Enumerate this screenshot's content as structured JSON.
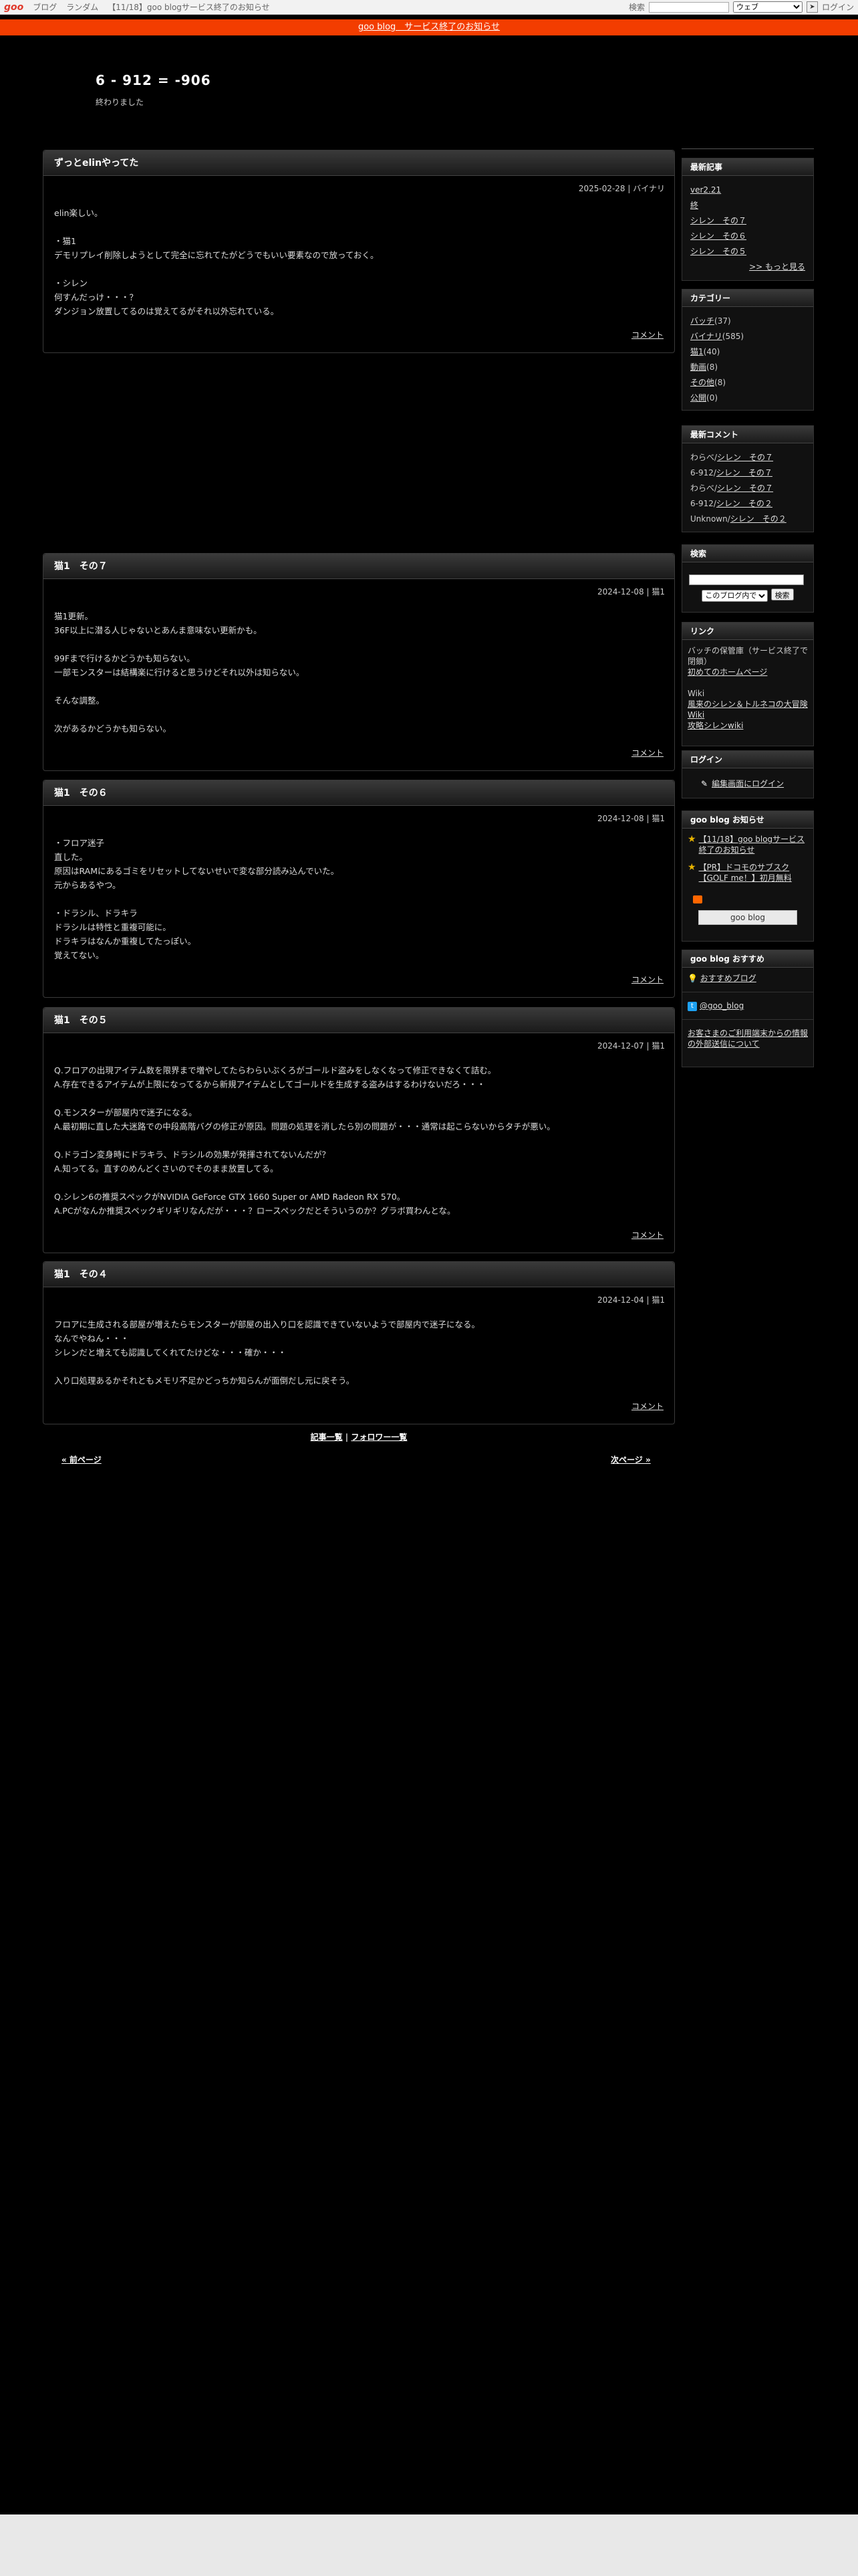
{
  "topbar": {
    "logo": "goo",
    "links": [
      "ブログ",
      "ランダム",
      "【11/18】goo blogサービス終了のお知らせ"
    ],
    "search_label": "検索",
    "search_select": "ウェブ",
    "login": "ログイン"
  },
  "notice": "goo blog　サービス終了のお知らせ",
  "blog": {
    "title": "6 - 912 = -906",
    "description": "終わりました"
  },
  "entries": [
    {
      "title": "ずっとelinやってた",
      "meta": "2025-02-28 | バイナリ",
      "body": "elin楽しい。\n\n・猫1\nデモリプレイ削除しようとして完全に忘れてたがどうでもいい要素なので放っておく。\n\n・シレン\n何すんだっけ・・・？\nダンジョン放置してるのは覚えてるがそれ以外忘れている。",
      "footer": "コメント"
    },
    {
      "title": "猫1　その７",
      "meta": "2024-12-08 | 猫1",
      "body": "猫1更新。\n36F以上に潜る人じゃないとあんま意味ない更新かも。\n\n99Fまで行けるかどうかも知らない。\n一部モンスターは結構楽に行けると思うけどそれ以外は知らない。\n\nそんな調整。\n\n次があるかどうかも知らない。",
      "footer": "コメント"
    },
    {
      "title": "猫1　その６",
      "meta": "2024-12-08 | 猫1",
      "body": "・フロア迷子\n直した。\n原因はRAMにあるゴミをリセットしてないせいで変な部分読み込んでいた。\n元からあるやつ。\n\n・ドラシル、ドラキラ\nドラシルは特性と重複可能に。\nドラキラはなんか重複してたっぽい。\n覚えてない。",
      "footer": "コメント"
    },
    {
      "title": "猫1　その５",
      "meta": "2024-12-07 | 猫1",
      "body": "Q.フロアの出現アイテム数を限界まで増やしてたらわらいぶくろがゴールド盗みをしなくなって修正できなくて詰む。\nA.存在できるアイテムが上限になってるから新規アイテムとしてゴールドを生成する盗みはするわけないだろ・・・\n\nQ.モンスターが部屋内で迷子になる。\nA.最初期に直した大迷路での中段高階バグの修正が原因。問題の処理を消したら別の問題が・・・通常は起こらないからタチが悪い。\n\nQ.ドラゴン変身時にドラキラ、ドラシルの効果が発揮されてないんだが？\nA.知ってる。直すのめんどくさいのでそのまま放置してる。\n\nQ.シレン6の推奨スペックがNVIDIA GeForce GTX 1660 Super or AMD Radeon RX 570。\nA.PCがなんか推奨スペックギリギリなんだが・・・？ロースペックだとそういうのか？グラボ買わんとな。",
      "footer": "コメント"
    },
    {
      "title": "猫1　その４",
      "meta": "2024-12-04 | 猫1",
      "body": "フロアに生成される部屋が増えたらモンスターが部屋の出入り口を認識できていないようで部屋内で迷子になる。\nなんでやねん・・・\nシレンだと増えても認識してくれてたけどな・・・確か・・・\n\n入り口処理あるかそれともメモリ不足かどっちか知らんが面倒だし元に戻そう。",
      "footer": "コメント"
    }
  ],
  "pager": {
    "middle_a": "記事一覧",
    "sep": " | ",
    "middle_b": "フォロワー一覧",
    "prev": "« 前ページ",
    "next": "次ページ »"
  },
  "sidebar": {
    "recent": {
      "title": "最新記事",
      "items": [
        "ver2.21",
        "終",
        "シレン　その７",
        "シレン　その６",
        "シレン　その５"
      ],
      "more": ">> もっと見る"
    },
    "category": {
      "title": "カテゴリー",
      "items": [
        {
          "name": "バッチ",
          "count": "(37)"
        },
        {
          "name": "バイナリ",
          "count": "(585)"
        },
        {
          "name": "猫1",
          "count": "(40)"
        },
        {
          "name": "動画",
          "count": "(8)"
        },
        {
          "name": "その他",
          "count": "(8)"
        },
        {
          "name": "公開",
          "count": "(0)"
        }
      ]
    },
    "comments": {
      "title": "最新コメント",
      "items": [
        {
          "who": "わらべ/",
          "post": "シレン　その７"
        },
        {
          "who": "6-912/",
          "post": "シレン　その７"
        },
        {
          "who": "わらべ/",
          "post": "シレン　その７"
        },
        {
          "who": "6-912/",
          "post": "シレン　その２"
        },
        {
          "who": "Unknown/",
          "post": "シレン　その２"
        }
      ]
    },
    "search": {
      "title": "検索",
      "select": "このブログ内で",
      "button": "検索"
    },
    "links": {
      "title": "リンク",
      "line1": "バッチの保管庫（サービス終了で閉鎖）",
      "line2": "初めてのホームページ",
      "wiki": "Wiki",
      "line3": "風来のシレン＆トルネコの大冒険 Wiki",
      "line4": "攻略シレンwiki"
    },
    "login": {
      "title": "ログイン",
      "link": "編集画面にログイン"
    },
    "goo_notice": {
      "title": "goo blog お知らせ",
      "item1": "【11/18】goo blogサービス終了のお知らせ",
      "item2": "【PR】ドコモのサブスク【GOLF me！】初月無料",
      "logo": "goo blog"
    },
    "recommend": {
      "title": "goo blog おすすめ",
      "item1": "おすすめブログ",
      "twitter": "@goo_blog",
      "external": "お客さまのご利用端末からの情報の外部送信について"
    }
  }
}
